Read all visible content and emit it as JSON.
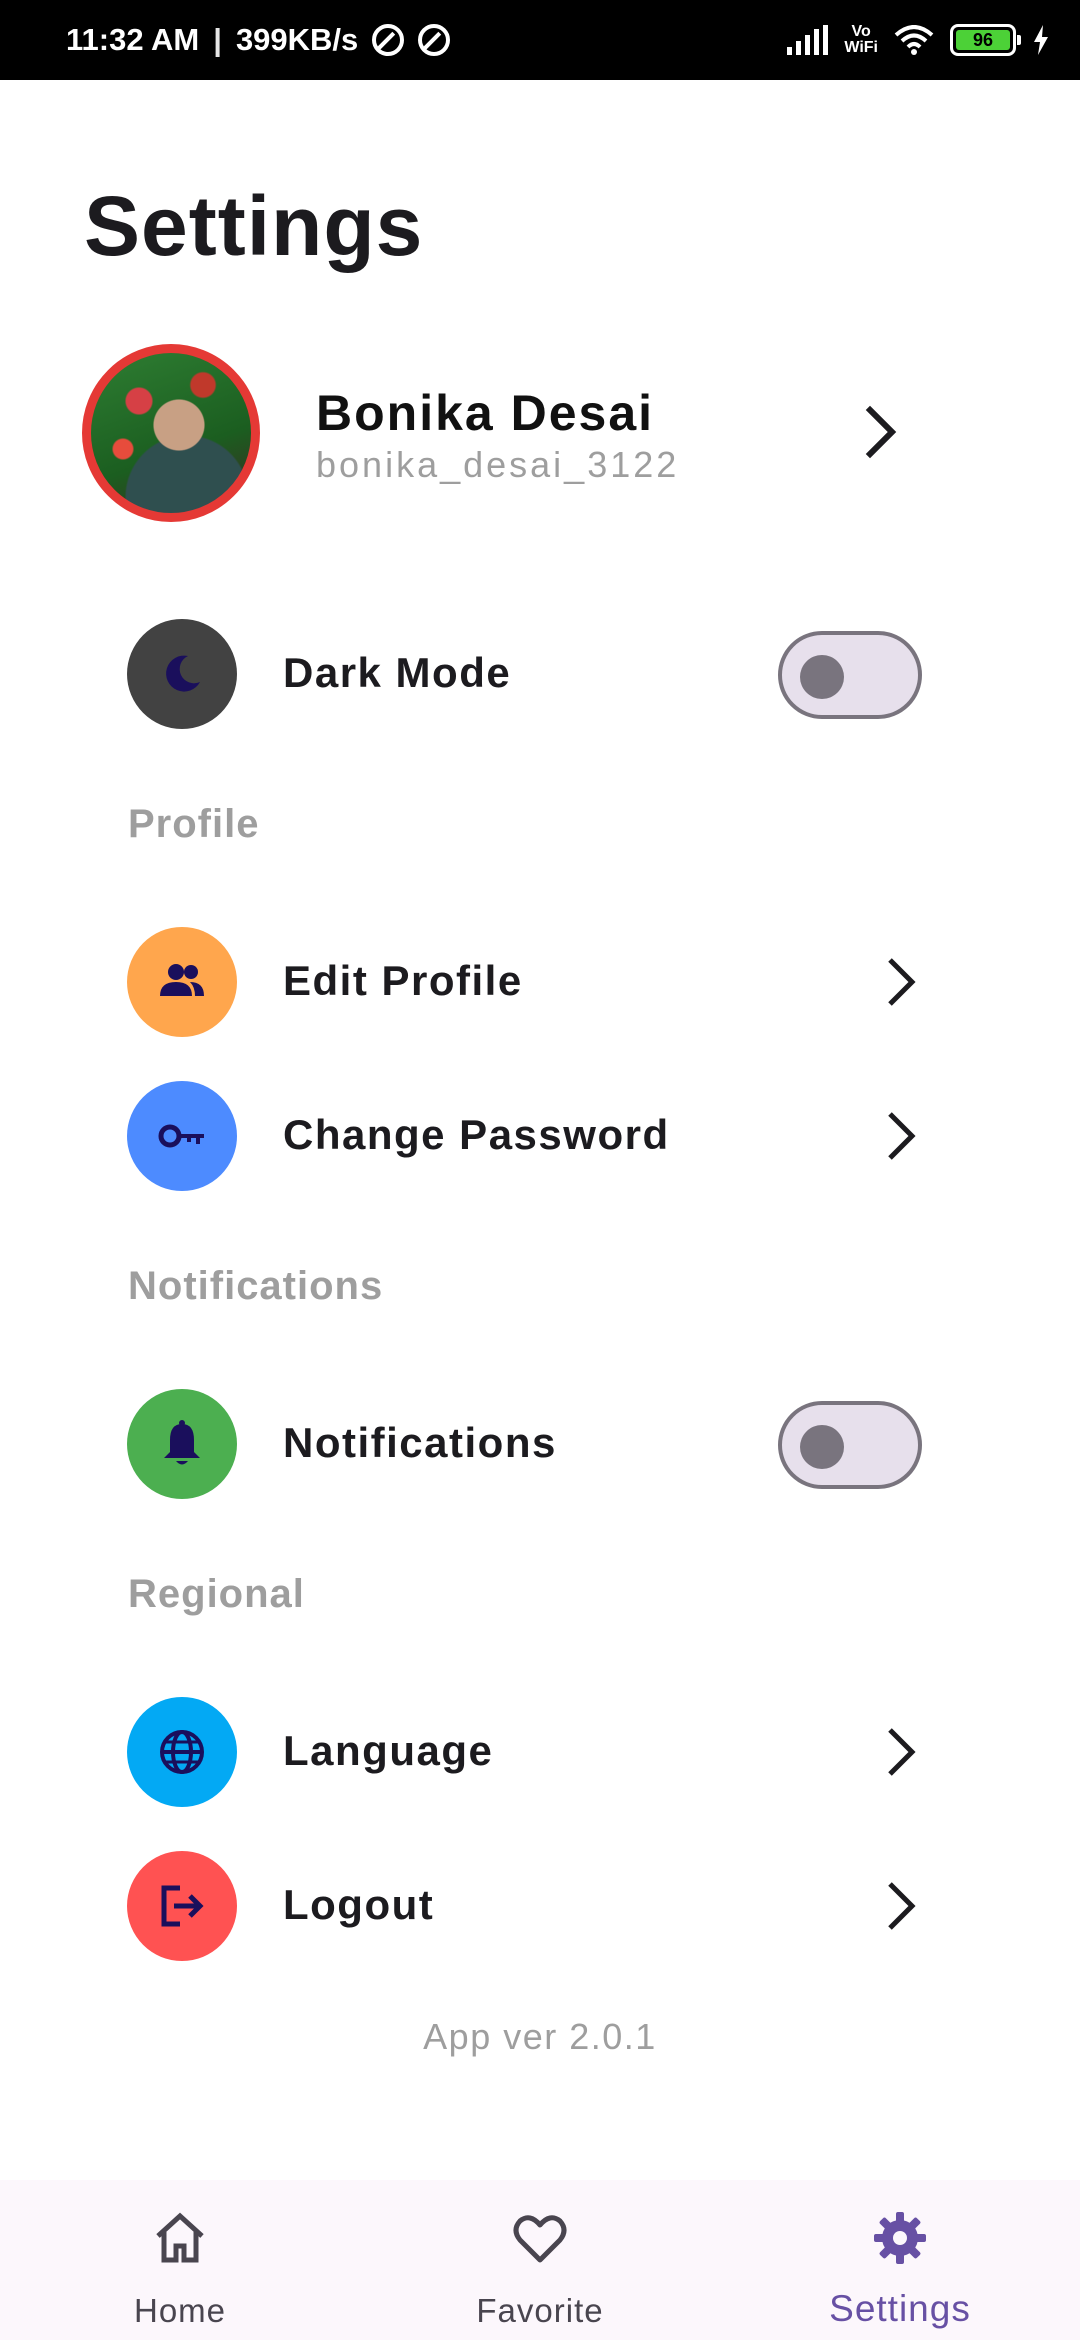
{
  "status_bar": {
    "time": "11:32 AM",
    "separator": "|",
    "speed": "399KB/s",
    "vowifi_top": "Vo",
    "vowifi_bottom": "WiFi",
    "battery": "96"
  },
  "page": {
    "title": "Settings"
  },
  "profile": {
    "name": "Bonika Desai",
    "handle": "bonika_desai_3122"
  },
  "dark_mode": {
    "label": "Dark Mode",
    "enabled": false
  },
  "sections": {
    "profile": "Profile",
    "notifications": "Notifications",
    "regional": "Regional"
  },
  "items": {
    "edit_profile": "Edit Profile",
    "change_password": "Change Password",
    "notifications": "Notifications",
    "language": "Language",
    "logout": "Logout"
  },
  "notifications_toggle": {
    "enabled": false
  },
  "app_version": "App ver 2.0.1",
  "bottom_nav": {
    "home": "Home",
    "favorite": "Favorite",
    "settings": "Settings",
    "active": "settings"
  },
  "colors": {
    "dark_mode_icon_bg": "#424242",
    "edit_profile_icon_bg": "#ffa64d",
    "change_password_icon_bg": "#4d8bff",
    "notifications_icon_bg": "#4caf50",
    "language_icon_bg": "#03a9f4",
    "logout_icon_bg": "#ff5252",
    "icon_glyph": "#1a0f5c",
    "accent": "#6750a4",
    "avatar_ring": "#e53935"
  },
  "icons": {
    "dark_mode": "moon-icon",
    "edit_profile": "people-icon",
    "change_password": "key-icon",
    "notifications": "bell-icon",
    "language": "globe-icon",
    "logout": "logout-icon"
  }
}
